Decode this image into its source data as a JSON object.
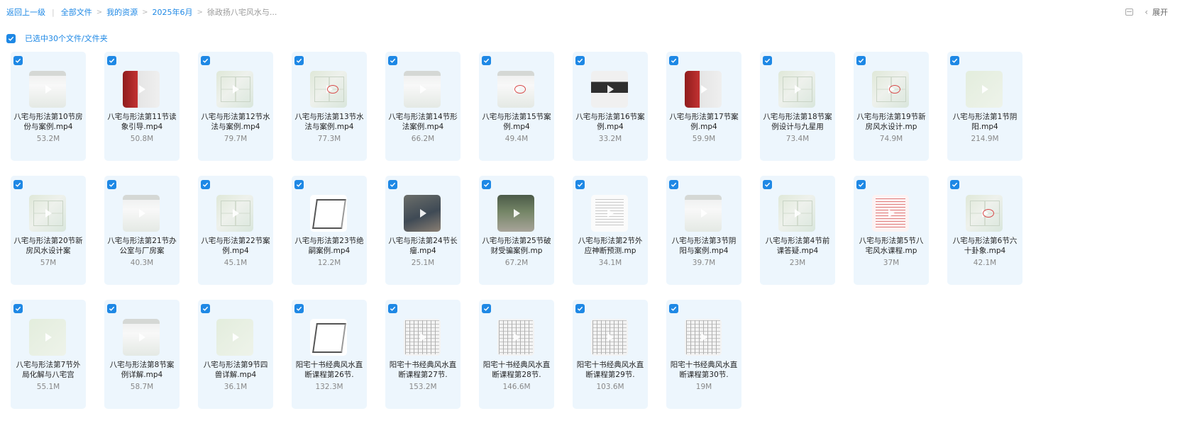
{
  "breadcrumb": {
    "back": "返回上一级",
    "items": [
      "全部文件",
      "我的资源",
      "2025年6月"
    ],
    "current": "徐政扬八宅风水与..."
  },
  "top_right": {
    "expand": "展开"
  },
  "selection": {
    "text": "已选中30个文件/文件夹"
  },
  "files": [
    {
      "name": "八宅与形法第10节房份与案例.mp4",
      "size": "53.2M",
      "thumb": "screen"
    },
    {
      "name": "八宅与形法第11节读象引导.mp4",
      "size": "50.8M",
      "thumb": "photo-red"
    },
    {
      "name": "八宅与形法第12节水法与案例.mp4",
      "size": "79.7M",
      "thumb": "map"
    },
    {
      "name": "八宅与形法第13节水法与案例.mp4",
      "size": "77.3M",
      "thumb": "map-red"
    },
    {
      "name": "八宅与形法第14节形法案例.mp4",
      "size": "66.2M",
      "thumb": "screen"
    },
    {
      "name": "八宅与形法第15节案例.mp4",
      "size": "49.4M",
      "thumb": "screen-red"
    },
    {
      "name": "八宅与形法第16节案例.mp4",
      "size": "33.2M",
      "thumb": "blackbox"
    },
    {
      "name": "八宅与形法第17节案例.mp4",
      "size": "59.9M",
      "thumb": "photo-red"
    },
    {
      "name": "八宅与形法第18节案例设计与九星用",
      "size": "73.4M",
      "thumb": "map"
    },
    {
      "name": "八宅与形法第19节新房风水设计.mp",
      "size": "74.9M",
      "thumb": "map-red"
    },
    {
      "name": "八宅与形法第1节阴阳.mp4",
      "size": "214.9M",
      "thumb": "green"
    },
    {
      "name": "八宅与形法第20节新房风水设计案",
      "size": "57M",
      "thumb": "map"
    },
    {
      "name": "八宅与形法第21节办公室与厂房案",
      "size": "40.3M",
      "thumb": "screen"
    },
    {
      "name": "八宅与形法第22节案例.mp4",
      "size": "45.1M",
      "thumb": "map"
    },
    {
      "name": "八宅与形法第23节绝嗣案例.mp4",
      "size": "12.2M",
      "thumb": "plan"
    },
    {
      "name": "八宅与形法第24节长瘤.mp4",
      "size": "25.1M",
      "thumb": "photo-dark"
    },
    {
      "name": "八宅与形法第25节破财受骗案例.mp",
      "size": "67.2M",
      "thumb": "photo-tree"
    },
    {
      "name": "八宅与形法第2节外应神断预测.mp",
      "size": "34.1M",
      "thumb": "text"
    },
    {
      "name": "八宅与形法第3节阴阳与案例.mp4",
      "size": "39.7M",
      "thumb": "screen"
    },
    {
      "name": "八宅与形法第4节前课答疑.mp4",
      "size": "23M",
      "thumb": "map"
    },
    {
      "name": "八宅与形法第5节八宅风水课程.mp",
      "size": "37M",
      "thumb": "pinktext"
    },
    {
      "name": "八宅与形法第6节六十卦象.mp4",
      "size": "42.1M",
      "thumb": "map-red"
    },
    {
      "name": "八宅与形法第7节外局化解与八宅宫",
      "size": "55.1M",
      "thumb": "green"
    },
    {
      "name": "八宅与形法第8节案例详解.mp4",
      "size": "58.7M",
      "thumb": "screen"
    },
    {
      "name": "八宅与形法第9节四兽详解.mp4",
      "size": "36.1M",
      "thumb": "green"
    },
    {
      "name": "阳宅十书经典风水直断课程第26节.",
      "size": "132.3M",
      "thumb": "plan"
    },
    {
      "name": "阳宅十书经典风水直断课程第27节.",
      "size": "153.2M",
      "thumb": "table"
    },
    {
      "name": "阳宅十书经典风水直断课程第28节.",
      "size": "146.6M",
      "thumb": "table"
    },
    {
      "name": "阳宅十书经典风水直断课程第29节.",
      "size": "103.6M",
      "thumb": "table"
    },
    {
      "name": "阳宅十书经典风水直断课程第30节.",
      "size": "19M",
      "thumb": "table"
    }
  ],
  "colors": {
    "accent": "#1e88e5",
    "card_bg": "#edf6fd"
  },
  "icons": [
    "list-view-icon",
    "chevron-left-icon",
    "play-icon",
    "checkbox-checked-icon"
  ]
}
